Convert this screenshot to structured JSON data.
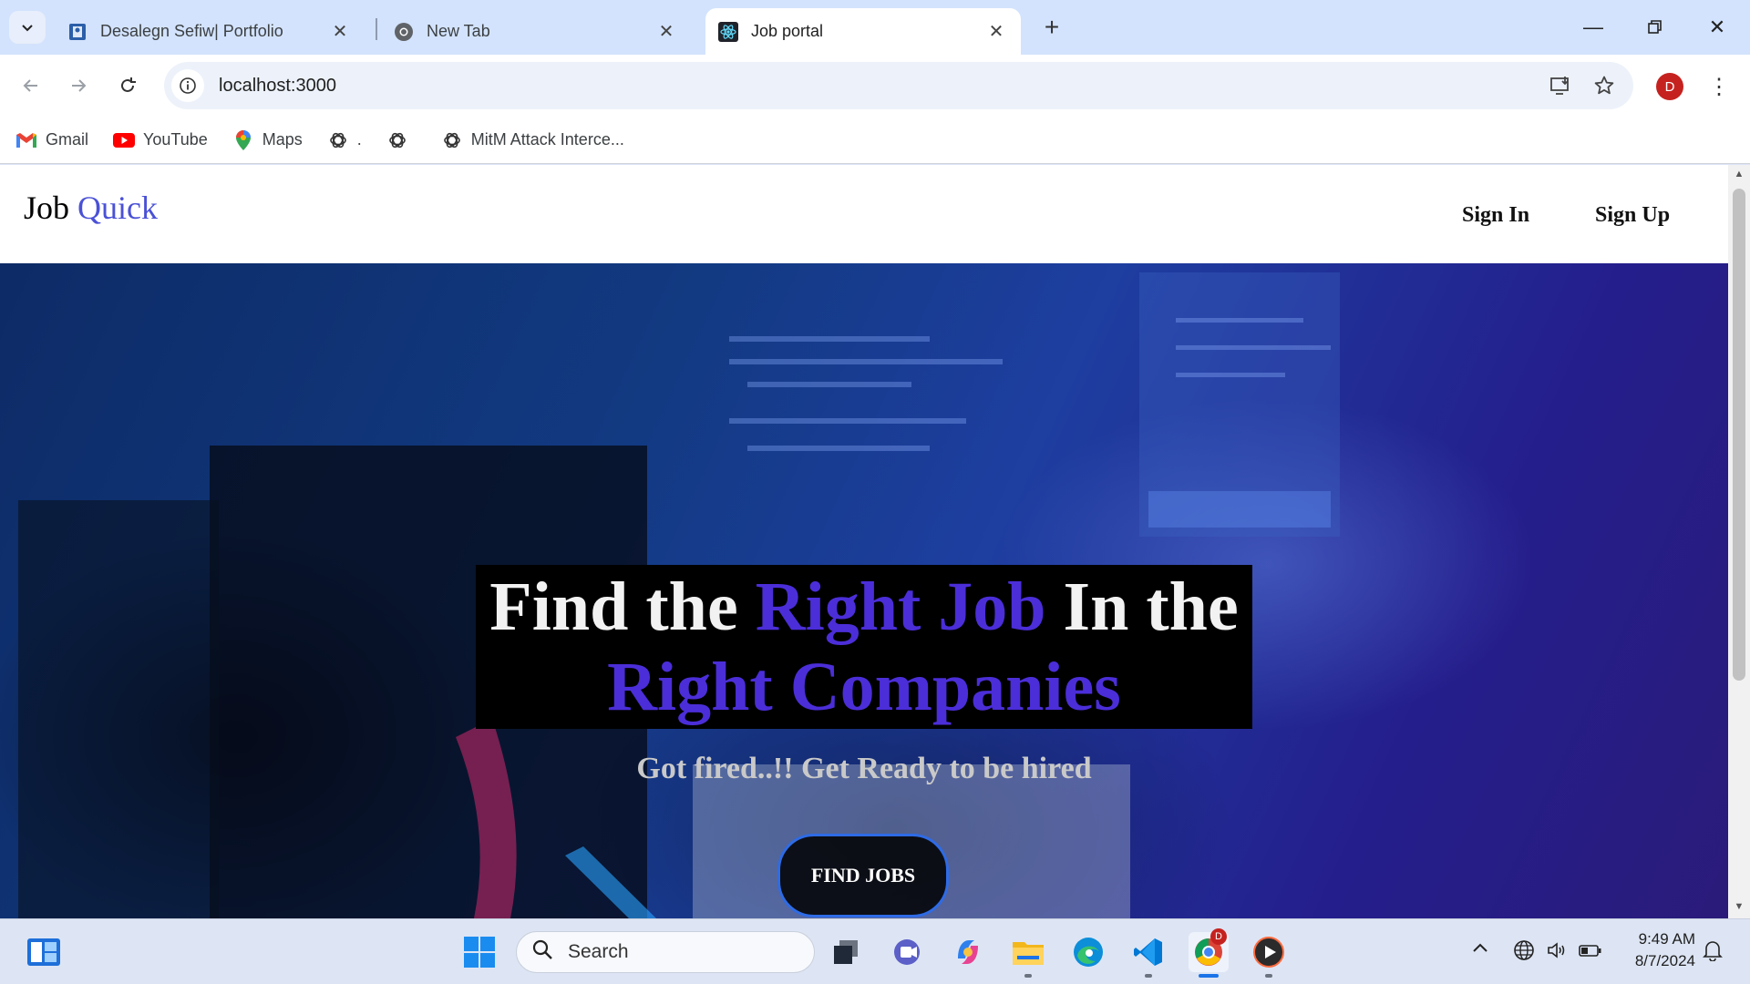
{
  "browser": {
    "tabs": [
      {
        "title": "Desalegn Sefiw| Portfolio",
        "active": false,
        "icon": "portfolio-favicon"
      },
      {
        "title": "New Tab",
        "active": false,
        "icon": "chrome-favicon"
      },
      {
        "title": "Job portal",
        "active": true,
        "icon": "react-favicon"
      }
    ],
    "url": "localhost:3000",
    "profile_initial": "D",
    "bookmarks": [
      {
        "label": "Gmail",
        "icon": "gmail-icon"
      },
      {
        "label": "YouTube",
        "icon": "youtube-icon"
      },
      {
        "label": "Maps",
        "icon": "maps-icon"
      },
      {
        "label": ".",
        "icon": "openai-icon"
      },
      {
        "label": "",
        "icon": "openai-icon"
      },
      {
        "label": "MitM Attack Interce...",
        "icon": "openai-icon"
      }
    ]
  },
  "site": {
    "logo_part1": "Job",
    "logo_part2": "Quick",
    "nav": {
      "sign_in": "Sign In",
      "sign_up": "Sign Up"
    },
    "hero": {
      "title_w1": "Find the",
      "title_hl1": "Right Job",
      "title_w2": "In the",
      "title_hl2": "Right Companies",
      "subtitle": "Got fired..!! Get Ready to be hired",
      "cta": "FIND JOBS"
    },
    "colors": {
      "accent": "#4a51d6",
      "highlight": "#4b2ed8",
      "cta_border": "#2e6be6"
    }
  },
  "taskbar": {
    "search_placeholder": "Search",
    "time": "9:49 AM",
    "date": "8/7/2024",
    "chrome_badge": "D"
  }
}
